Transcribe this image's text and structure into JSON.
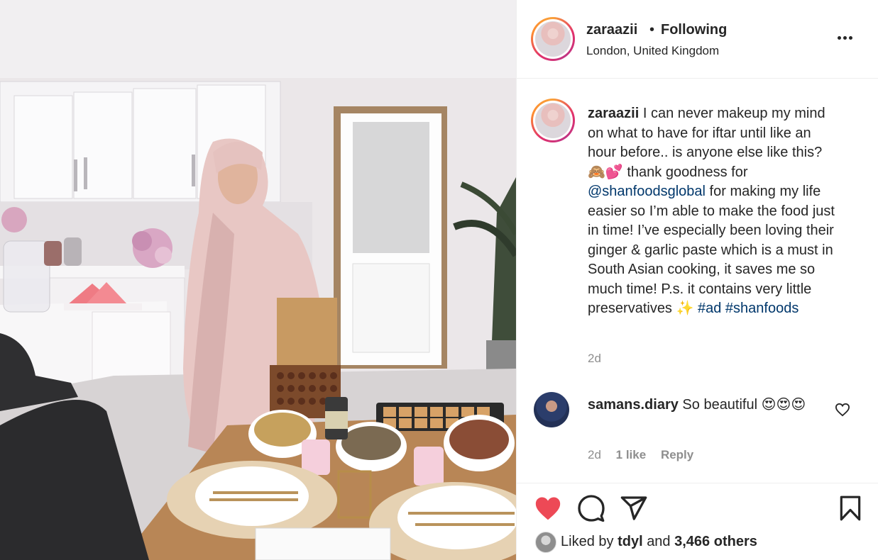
{
  "post": {
    "username": "zaraazii",
    "separator": "•",
    "follow_status": "Following",
    "location": "London, United Kingdom"
  },
  "caption": {
    "username": "zaraazii",
    "text_part1": "I can never makeup my mind on what to have for iftar until like an hour before.. is anyone else like this? 🙈💕 thank goodness for",
    "mention": "@shanfoodsglobal",
    "text_part2": "for making my life easier so I’m able to make the food just in time! I’ve especially been loving their ginger & garlic paste which is a must in South Asian cooking, it saves me so much time! P.s. it contains very little preservatives ✨",
    "hashtag1": "#ad",
    "hashtag2": "#shanfoods",
    "time": "2d"
  },
  "comment": {
    "username": "samans.diary",
    "text": "So beautiful 😍😍😍",
    "time": "2d",
    "likes": "1 like",
    "reply_label": "Reply"
  },
  "likes_line": {
    "prefix": "Liked by",
    "user": "tdyl",
    "and": "and",
    "others": "3,466 others"
  },
  "icons": {
    "like": "heart-filled-icon",
    "comment": "comment-bubble-icon",
    "share": "paper-plane-icon",
    "save": "bookmark-icon",
    "more": "more-dots-icon"
  },
  "colors": {
    "like_red": "#ed4956",
    "link_blue": "#00376b",
    "muted_gray": "#8e8e8e",
    "text": "#262626"
  }
}
